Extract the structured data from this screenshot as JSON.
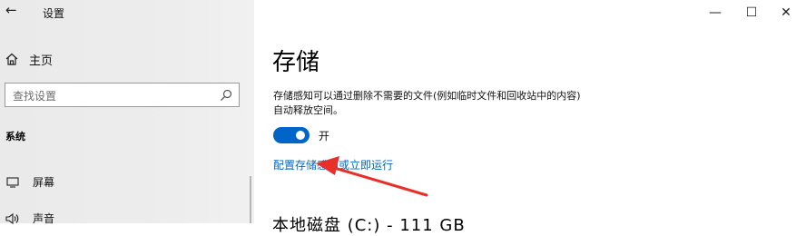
{
  "window": {
    "title": "设置",
    "back_icon": "back-arrow-icon",
    "controls": {
      "minimize": "—",
      "maximize": "☐",
      "close": "✕"
    }
  },
  "sidebar": {
    "home_label": "主页",
    "search_placeholder": "查找设置",
    "section_label": "系统",
    "items": [
      {
        "label": "屏幕",
        "icon": "display-icon"
      },
      {
        "label": "声音",
        "icon": "speaker-icon"
      }
    ]
  },
  "main": {
    "title": "存储",
    "description_line1": "存储感知可以通过删除不需要的文件(例如临时文件和回收站中的内容)",
    "description_line2": "自动释放空间。",
    "toggle": {
      "state": true,
      "label": "开"
    },
    "link": "配置存储感知或立即运行",
    "next_heading_partial": "本地磁盘 (C:) - 111 GB"
  },
  "colors": {
    "accent": "#0064c8",
    "link": "#0067c0",
    "annotation_arrow": "#e8302a"
  }
}
